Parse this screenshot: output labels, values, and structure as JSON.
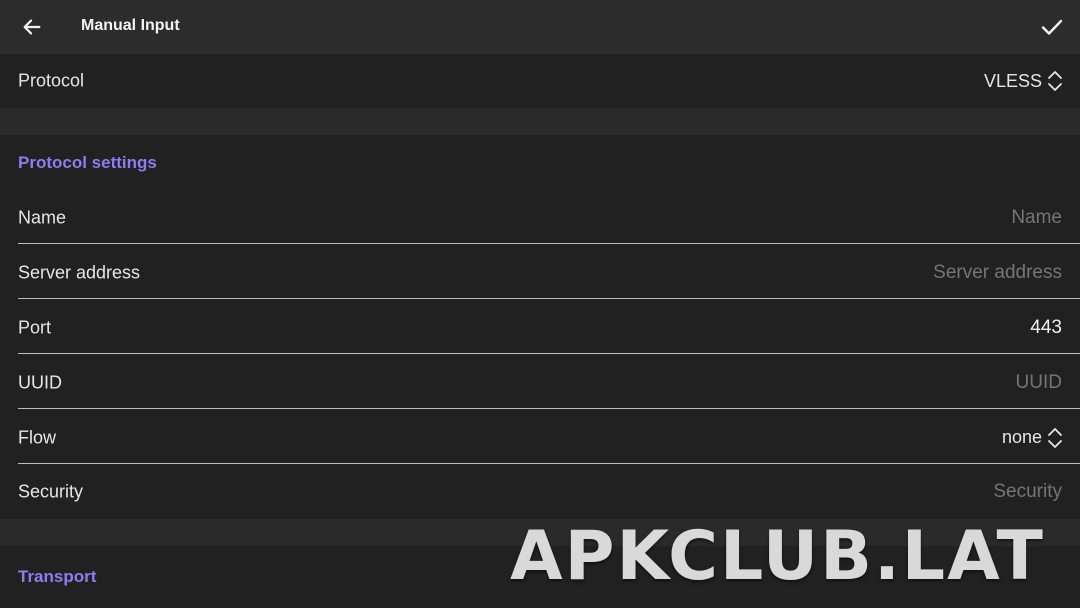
{
  "header": {
    "title": "Manual Input",
    "back_icon": "arrow-left-icon",
    "confirm_icon": "check-icon"
  },
  "protocol": {
    "label": "Protocol",
    "value": "VLESS"
  },
  "protocol_settings": {
    "heading": "Protocol settings",
    "fields": {
      "name": {
        "label": "Name",
        "placeholder": "Name",
        "value": ""
      },
      "server_address": {
        "label": "Server address",
        "placeholder": "Server address",
        "value": ""
      },
      "port": {
        "label": "Port",
        "placeholder": "",
        "value": "443"
      },
      "uuid": {
        "label": "UUID",
        "placeholder": "UUID",
        "value": ""
      },
      "flow": {
        "label": "Flow",
        "value": "none"
      },
      "security": {
        "label": "Security",
        "placeholder": "Security",
        "value": ""
      }
    }
  },
  "transport": {
    "heading": "Transport"
  },
  "watermark": "APKCLUB.LAT",
  "colors": {
    "accent": "#8f7bf2",
    "background": "#212121",
    "appbar": "#2c2c2c"
  }
}
